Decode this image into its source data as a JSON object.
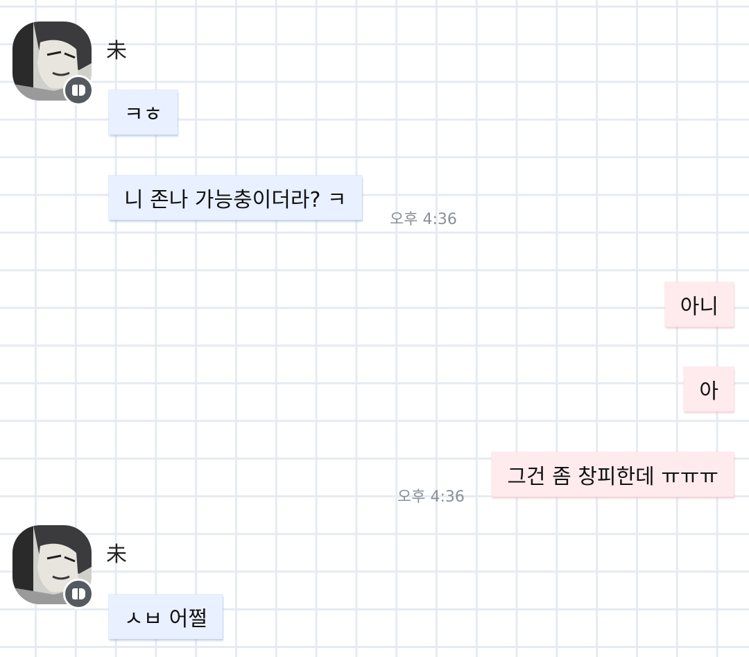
{
  "messages": [
    {
      "sender": "未",
      "direction": "incoming",
      "bubbles": [
        "ㅋㅎ",
        "니 존나 가능충이더라? ㅋ"
      ],
      "time": "오후 4:36"
    },
    {
      "direction": "outgoing",
      "bubbles": [
        "아니",
        "아",
        "그건 좀 창피한데 ㅠㅠㅠ"
      ],
      "time": "오후 4:36"
    },
    {
      "sender": "未",
      "direction": "incoming",
      "bubbles": [
        "ㅅㅂ 어쩔"
      ]
    }
  ],
  "colors": {
    "incoming_bubble": "#e9f0ff",
    "outgoing_bubble": "#ffebee",
    "grid_line": "#e6ebf1",
    "badge": "#555a60"
  },
  "icons": {
    "profile_badge": "chat-app-badge-icon",
    "avatar": "profile-avatar"
  }
}
